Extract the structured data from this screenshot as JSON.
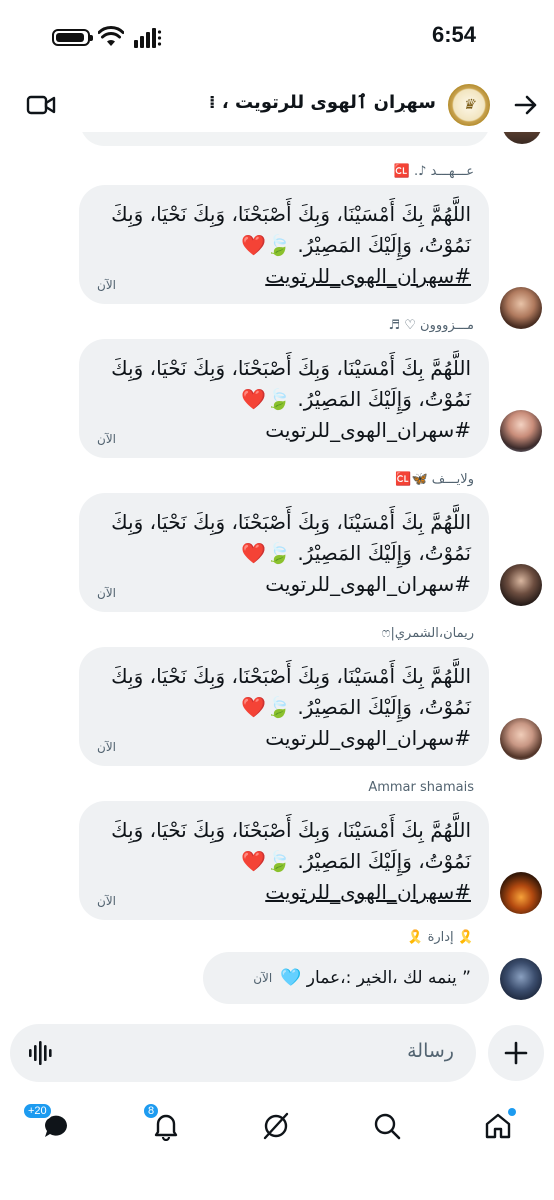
{
  "status_bar": {
    "time": "6:54"
  },
  "header": {
    "title": "سهڔان ٱلهوى للرتويت ، ⁞"
  },
  "messages": [
    {
      "sender": "عـــهـــد ♪. 🆑",
      "text": "اللَّهُمَّ بِكَ أَمْسَيْنَا، وَبِكَ أَصْبَحْنَا، وَبِكَ نَحْيَا، وَبِكَ نَمُوْتُ، وَإِلَيْكَ المَصِيْرُ. 🍃❤️",
      "tag": "#سهران_الهوى_للرتويت",
      "tag_underlined": true,
      "time": "الآن"
    },
    {
      "sender": "مـــزووون ♡ ♬",
      "text": "اللَّهُمَّ بِكَ أَمْسَيْنَا، وَبِكَ أَصْبَحْنَا، وَبِكَ نَحْيَا، وَبِكَ نَمُوْتُ، وَإِلَيْكَ المَصِيْرُ. 🍃❤️",
      "tag": "#سهران_الهوى_للرتويت",
      "tag_underlined": false,
      "time": "الآن"
    },
    {
      "sender": "ولايـــف 🦋🆑",
      "text": "اللَّهُمَّ بِكَ أَمْسَيْنَا، وَبِكَ أَصْبَحْنَا، وَبِكَ نَحْيَا، وَبِكَ نَمُوْتُ، وَإِلَيْكَ المَصِيْرُ. 🍃❤️",
      "tag": "#سهران_الهوى_للرتويت",
      "tag_underlined": false,
      "time": "الآن"
    },
    {
      "sender": "ريمان،الشمري|ෆ",
      "text": "اللَّهُمَّ بِكَ أَمْسَيْنَا، وَبِكَ أَصْبَحْنَا، وَبِكَ نَحْيَا، وَبِكَ نَمُوْتُ، وَإِلَيْكَ المَصِيْرُ. 🍃❤️",
      "tag": "#سهران_الهوى_للرتويت",
      "tag_underlined": false,
      "time": "الآن"
    },
    {
      "sender": "Ammar shamais",
      "text": "اللَّهُمَّ بِكَ أَمْسَيْنَا، وَبِكَ أَصْبَحْنَا، وَبِكَ نَحْيَا، وَبِكَ نَمُوْتُ، وَإِلَيْكَ المَصِيْرُ. 🍃❤️",
      "tag": "#سهران_الهوى_للرتويت",
      "tag_underlined": true,
      "time": "الآن"
    }
  ],
  "admin_message": {
    "sender": "🎗️ إدارة 🎗️",
    "text": "” ينمه لك ،الخير :،عمار 🩵",
    "time": "الآن"
  },
  "composer": {
    "placeholder": "رسالة"
  },
  "nav": {
    "messages_badge": "+20",
    "notifications_badge": "8"
  },
  "colors": {
    "accent": "#1d9bf0",
    "bubble": "#eff1f3",
    "muted": "#536471"
  }
}
